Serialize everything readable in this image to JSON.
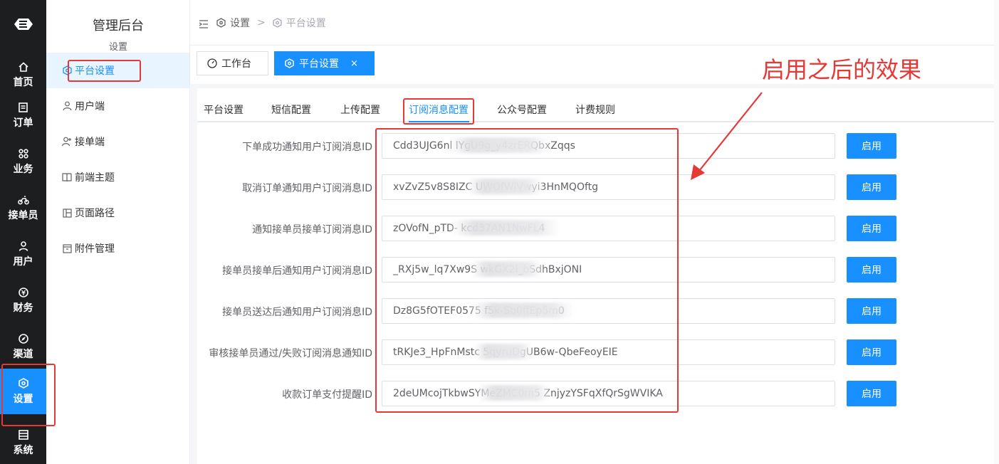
{
  "rail": {
    "items": [
      {
        "label": "首页",
        "icon": "home-icon"
      },
      {
        "label": "订单",
        "icon": "order-icon"
      },
      {
        "label": "业务",
        "icon": "business-icon"
      },
      {
        "label": "接单员",
        "icon": "bike-icon"
      },
      {
        "label": "用户",
        "icon": "user-icon"
      },
      {
        "label": "财务",
        "icon": "finance-icon"
      },
      {
        "label": "渠道",
        "icon": "channel-icon"
      },
      {
        "label": "设置",
        "icon": "settings-icon",
        "active": true
      },
      {
        "label": "系统",
        "icon": "system-icon"
      }
    ]
  },
  "subnav": {
    "title": "管理后台",
    "subtitle": "设置",
    "items": [
      {
        "label": "平台设置",
        "icon": "hexagon-gear-icon",
        "active": true
      },
      {
        "label": "用户端",
        "icon": "person-icon"
      },
      {
        "label": "接单端",
        "icon": "person-plus-icon"
      },
      {
        "label": "前端主题",
        "icon": "book-icon"
      },
      {
        "label": "页面路径",
        "icon": "layout-icon"
      },
      {
        "label": "附件管理",
        "icon": "archive-icon"
      }
    ]
  },
  "breadcrumb": {
    "item1": "设置",
    "separator": ">",
    "item2": "平台设置"
  },
  "tags": {
    "workbench": "工作台",
    "platform": "平台设置",
    "close": "×"
  },
  "subtabs": [
    "平台设置",
    "短信配置",
    "上传配置",
    "订阅消息配置",
    "公众号配置",
    "计费规则"
  ],
  "form": {
    "rows": [
      {
        "label": "下单成功通知用户订阅消息ID",
        "value": "Cdd3UJG6nl                    lYgU9g_y4zrERQbxZqqs",
        "button": "启用"
      },
      {
        "label": "取消订单通知用户订阅消息ID",
        "value": "xvZvZ5v8S8IZC                    UWOfWiVwyi3HnMQOftg",
        "button": "启用"
      },
      {
        "label": "通知接单员接单订阅消息ID",
        "value": "zOVofN_pTD-                          kcd37AN1NwFL4",
        "button": "启用"
      },
      {
        "label": "接单员接单后通知用户订阅消息ID",
        "value": "_RXj5w_lq7Xw9S                  wkGX2l_bSdhBxjONI",
        "button": "启用"
      },
      {
        "label": "接单员送达后通知用户订阅消息ID",
        "value": "Dz8G5fOTEF0575                       f5k-Sb0ffEp5m0",
        "button": "启用"
      },
      {
        "label": "审核接单员通过/失败订阅消息通知ID",
        "value": "tRKJe3_HpFnMstc             5qyruDgUB6w-QbeFeoyEIE",
        "button": "启用"
      },
      {
        "label": "收款订单支付提醒ID",
        "value": "2deUMcojTkbwSYMeZMC0m5    ZnjyzYSFqXfQrSgWVIKA",
        "button": "启用"
      }
    ]
  },
  "annotation": {
    "text": "启用之后的效果",
    "color": "#e53935"
  },
  "colors": {
    "primary": "#1890ff",
    "rail_bg": "#1d1e1f",
    "annotation_red": "#e53935"
  }
}
